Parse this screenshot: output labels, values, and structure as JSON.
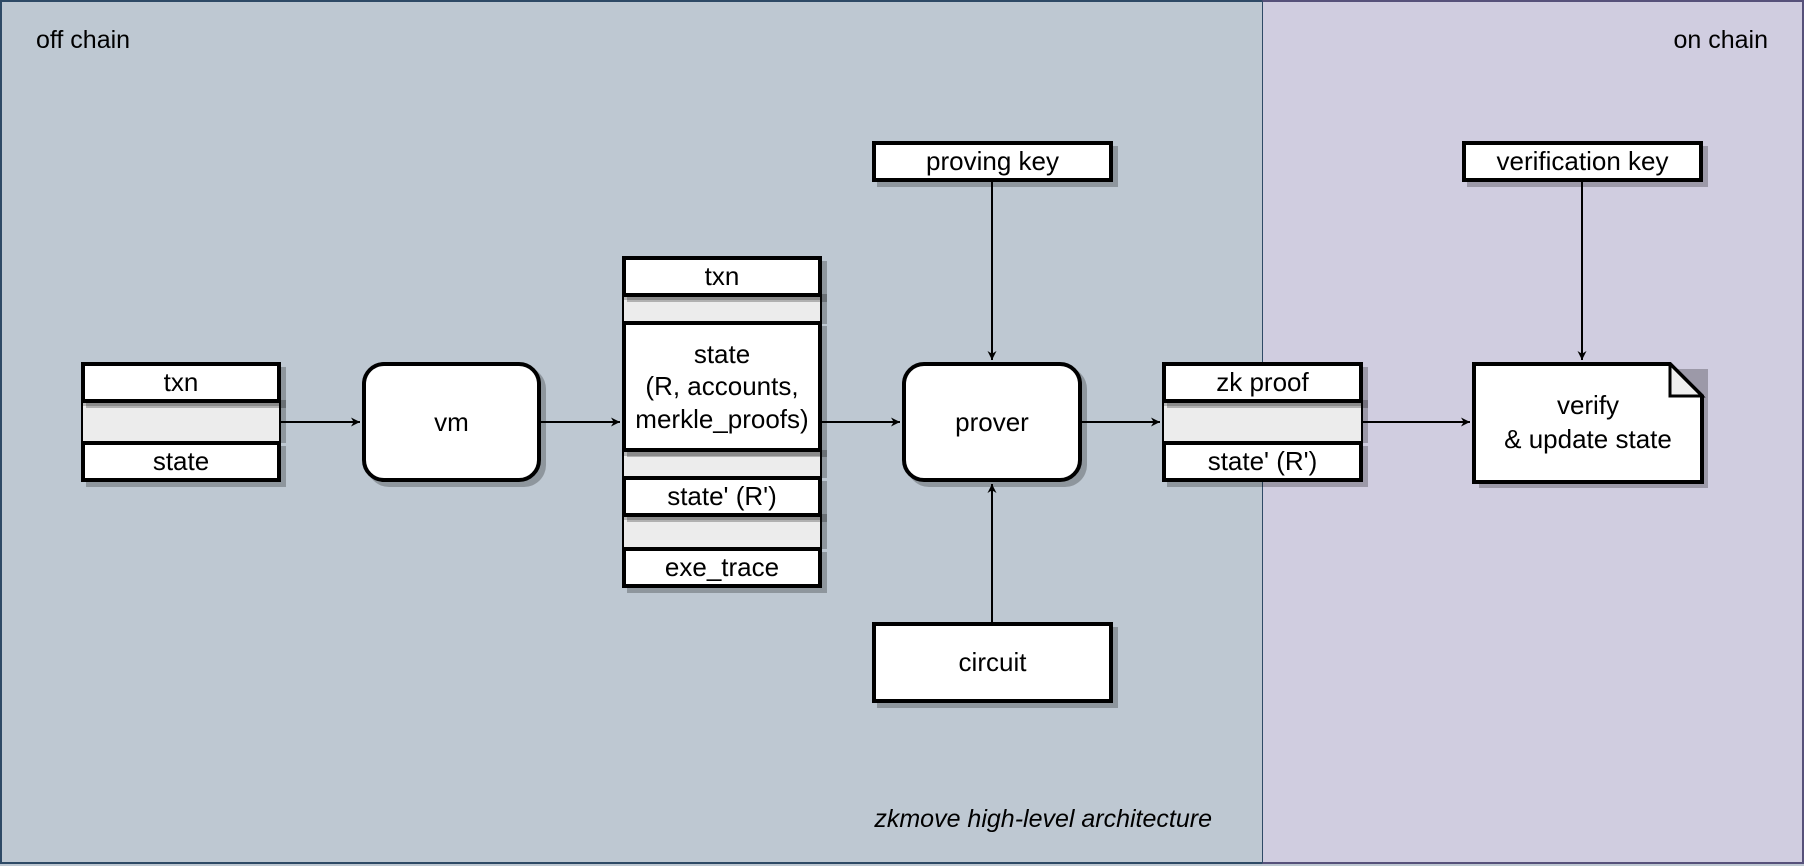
{
  "regions": {
    "off_chain": {
      "label": "off chain",
      "color": "#bec8d2"
    },
    "on_chain": {
      "label": "on chain",
      "color": "#d0cde0"
    }
  },
  "caption": "zkmove high-level architecture",
  "nodes": {
    "input_stack": {
      "top": "txn",
      "bottom": "state"
    },
    "vm": "vm",
    "vm_output_stack": {
      "item1": "txn",
      "item2_line1": "state",
      "item2_line2": "(R, accounts,",
      "item2_line3": "merkle_proofs)",
      "item3": "state' (R')",
      "item4": "exe_trace"
    },
    "proving_key": "proving key",
    "prover": "prover",
    "circuit": "circuit",
    "proof_stack": {
      "top": "zk proof",
      "bottom": "state' (R')"
    },
    "verification_key": "verification key",
    "verify": {
      "line1": "verify",
      "line2": "& update state"
    }
  },
  "edges": [
    {
      "from": "input_stack",
      "to": "vm"
    },
    {
      "from": "vm",
      "to": "vm_output_stack"
    },
    {
      "from": "vm_output_stack",
      "to": "prover"
    },
    {
      "from": "proving_key",
      "to": "prover"
    },
    {
      "from": "circuit",
      "to": "prover"
    },
    {
      "from": "prover",
      "to": "proof_stack"
    },
    {
      "from": "proof_stack",
      "to": "verify"
    },
    {
      "from": "verification_key",
      "to": "verify"
    }
  ]
}
